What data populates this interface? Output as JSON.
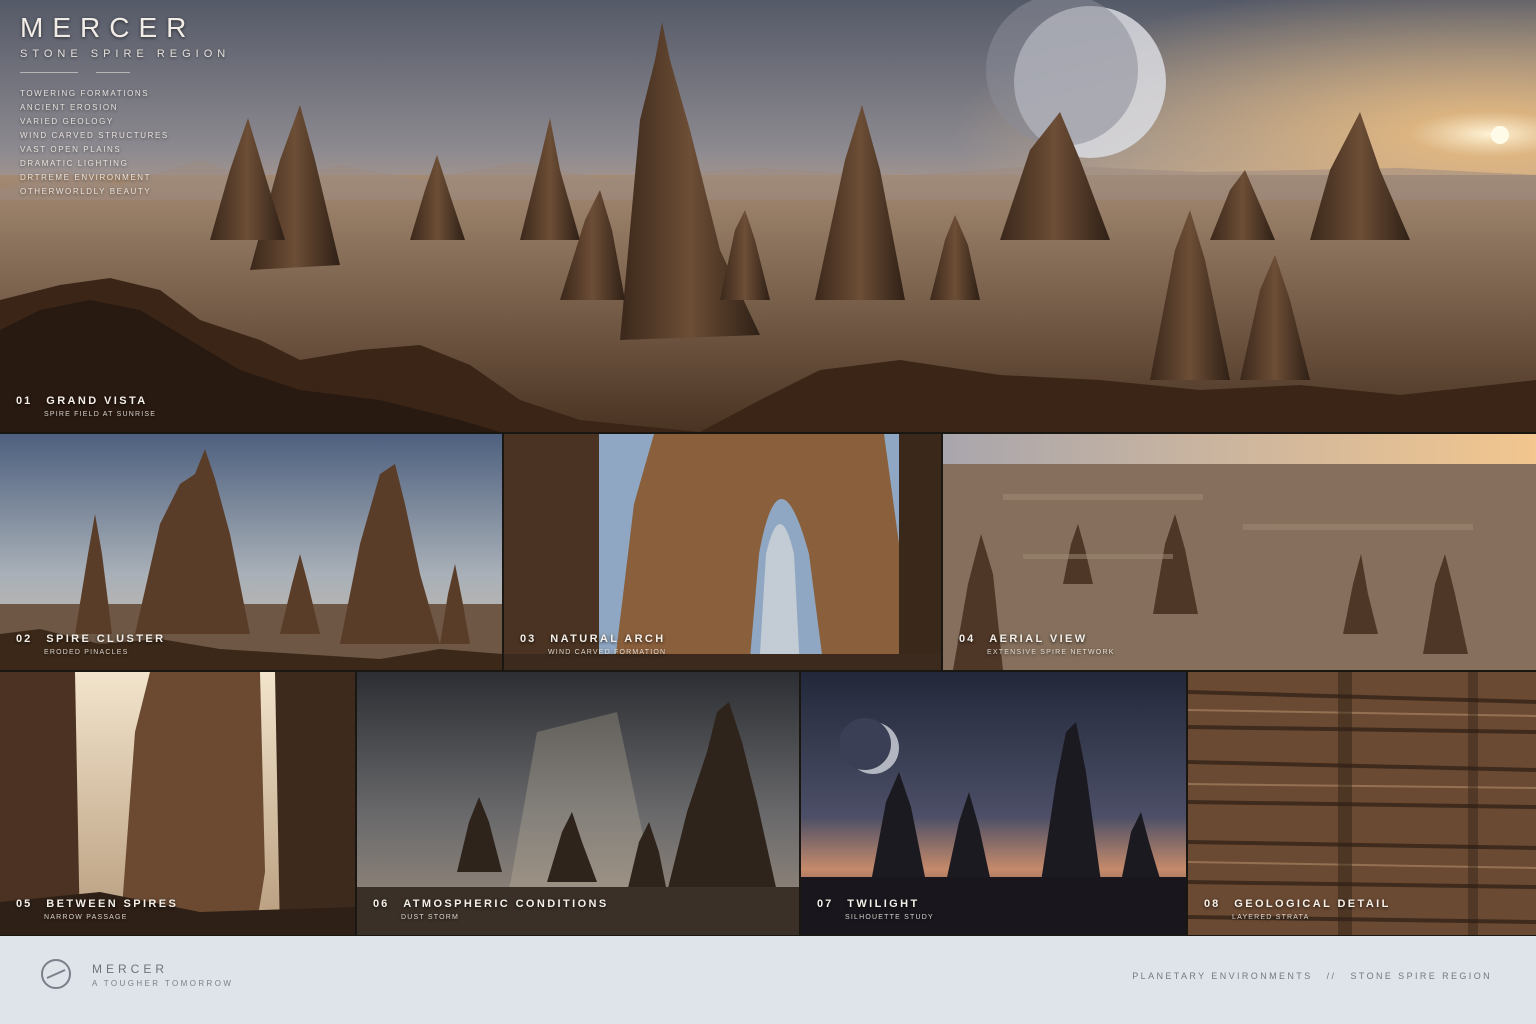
{
  "header": {
    "brand": "MERCER",
    "region": "STONE SPIRE REGION",
    "features": [
      "TOWERING FORMATIONS",
      "ANCIENT EROSION",
      "VARIED GEOLOGY",
      "WIND CARVED STRUCTURES",
      "VAST OPEN PLAINS",
      "DRAMATIC LIGHTING",
      "DRTREME ENVIRONMENT",
      "OTHERWORLDLY BEAUTY"
    ]
  },
  "panels": [
    {
      "num": "01",
      "title": "GRAND VISTA",
      "subtitle": "SPIRE FIELD AT SUNRISE",
      "icon": "spire-landscape"
    },
    {
      "num": "02",
      "title": "SPIRE CLUSTER",
      "subtitle": "ERODED PINACLES",
      "icon": "spire-cluster"
    },
    {
      "num": "03",
      "title": "NATURAL ARCH",
      "subtitle": "WIND CARVED FORMATION",
      "icon": "rock-arch"
    },
    {
      "num": "04",
      "title": "AERIAL VIEW",
      "subtitle": "EXTENSIVE SPIRE NETWORK",
      "icon": "aerial-plain"
    },
    {
      "num": "05",
      "title": "BETWEEN SPIRES",
      "subtitle": "NARROW PASSAGE",
      "icon": "canyon-passage"
    },
    {
      "num": "06",
      "title": "ATMOSPHERIC CONDITIONS",
      "subtitle": "DUST STORM",
      "icon": "storm-spires"
    },
    {
      "num": "07",
      "title": "TWILIGHT",
      "subtitle": "SILHOUETTE STUDY",
      "icon": "twilight-silhouette"
    },
    {
      "num": "08",
      "title": "GEOLOGICAL DETAIL",
      "subtitle": "LAYERED STRATA",
      "icon": "rock-strata"
    }
  ],
  "footer": {
    "brand": "MERCER",
    "tagline": "A TOUGHER TOMORROW",
    "section": "PLANETARY ENVIRONMENTS",
    "separator": "//",
    "region": "STONE SPIRE REGION"
  },
  "colors": {
    "sky_dawn": "#7b7a84",
    "sun_glow": "#e9b173",
    "rock": "#5a3f2b",
    "rock_light": "#9a7354",
    "ground": "#8b7259",
    "footer_bg": "#dfe3ea"
  }
}
